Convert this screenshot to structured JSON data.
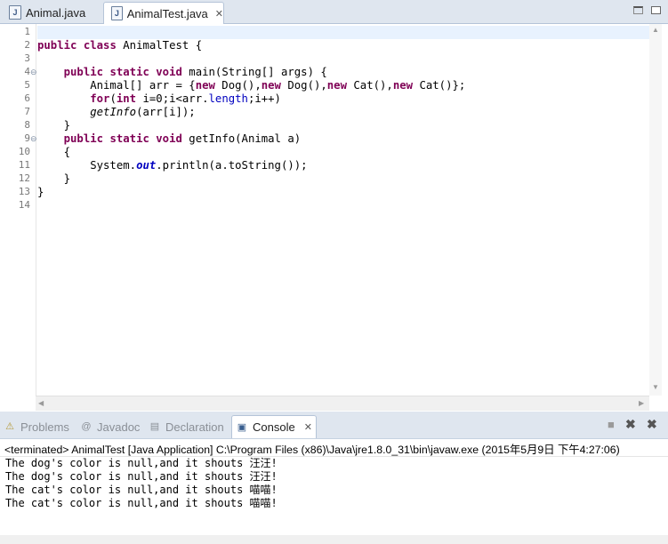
{
  "editor": {
    "tabs": [
      {
        "label": "Animal.java",
        "active": false,
        "icon": "java-file-icon"
      },
      {
        "label": "AnimalTest.java",
        "active": true,
        "icon": "java-file-icon",
        "close": "✕"
      }
    ],
    "line_numbers": [
      "1",
      "2",
      "3",
      "4",
      "5",
      "6",
      "7",
      "8",
      "9",
      "10",
      "11",
      "12",
      "13",
      "14"
    ],
    "code_lines": [
      [
        {
          "t": ""
        }
      ],
      [
        {
          "t": "public",
          "c": "kw"
        },
        {
          "t": " "
        },
        {
          "t": "class",
          "c": "kw"
        },
        {
          "t": " AnimalTest {"
        }
      ],
      [
        {
          "t": ""
        }
      ],
      [
        {
          "t": "    "
        },
        {
          "t": "public",
          "c": "kw"
        },
        {
          "t": " "
        },
        {
          "t": "static",
          "c": "kw"
        },
        {
          "t": " "
        },
        {
          "t": "void",
          "c": "kw"
        },
        {
          "t": " main(String[] args) {"
        }
      ],
      [
        {
          "t": "        Animal[] arr = {"
        },
        {
          "t": "new",
          "c": "kw"
        },
        {
          "t": " Dog(),"
        },
        {
          "t": "new",
          "c": "kw"
        },
        {
          "t": " Dog(),"
        },
        {
          "t": "new",
          "c": "kw"
        },
        {
          "t": " Cat(),"
        },
        {
          "t": "new",
          "c": "kw"
        },
        {
          "t": " Cat()};"
        }
      ],
      [
        {
          "t": "        "
        },
        {
          "t": "for",
          "c": "kw"
        },
        {
          "t": "("
        },
        {
          "t": "int",
          "c": "kw"
        },
        {
          "t": " i=0;i<arr."
        },
        {
          "t": "length",
          "c": "fld"
        },
        {
          "t": ";i++)"
        }
      ],
      [
        {
          "t": "        "
        },
        {
          "t": "getInfo",
          "c": "st"
        },
        {
          "t": "(arr[i]);"
        }
      ],
      [
        {
          "t": "    }"
        }
      ],
      [
        {
          "t": "    "
        },
        {
          "t": "public",
          "c": "kw"
        },
        {
          "t": " "
        },
        {
          "t": "static",
          "c": "kw"
        },
        {
          "t": " "
        },
        {
          "t": "void",
          "c": "kw"
        },
        {
          "t": " getInfo(Animal a)"
        }
      ],
      [
        {
          "t": "    {"
        }
      ],
      [
        {
          "t": "        System."
        },
        {
          "t": "out",
          "c": "sfld"
        },
        {
          "t": ".println(a.toString());"
        }
      ],
      [
        {
          "t": "    }"
        }
      ],
      [
        {
          "t": "}"
        }
      ],
      [
        {
          "t": ""
        }
      ]
    ]
  },
  "views": {
    "tabs": [
      {
        "label": "Problems",
        "icon": "problems-icon",
        "glyph": "⚠",
        "active": false
      },
      {
        "label": "Javadoc",
        "icon": "javadoc-icon",
        "glyph": "@",
        "active": false
      },
      {
        "label": "Declaration",
        "icon": "declaration-icon",
        "glyph": "▤",
        "active": false
      },
      {
        "label": "Console",
        "icon": "console-icon",
        "glyph": "▣",
        "active": true,
        "close": "✕"
      }
    ],
    "console": {
      "terminated_line": "<terminated> AnimalTest [Java Application] C:\\Program Files (x86)\\Java\\jre1.8.0_31\\bin\\javaw.exe (2015年5月9日 下午4:27:06)",
      "output": [
        "The dog's color is null,and it shouts 汪汪!",
        "The dog's color is null,and it shouts 汪汪!",
        "The cat's color is null,and it shouts 喵喵!",
        "The cat's color is null,and it shouts 喵喵!"
      ]
    }
  },
  "colors": {
    "keyword": "#7f0055",
    "field": "#0000c0",
    "background": "#dfe6ef"
  }
}
